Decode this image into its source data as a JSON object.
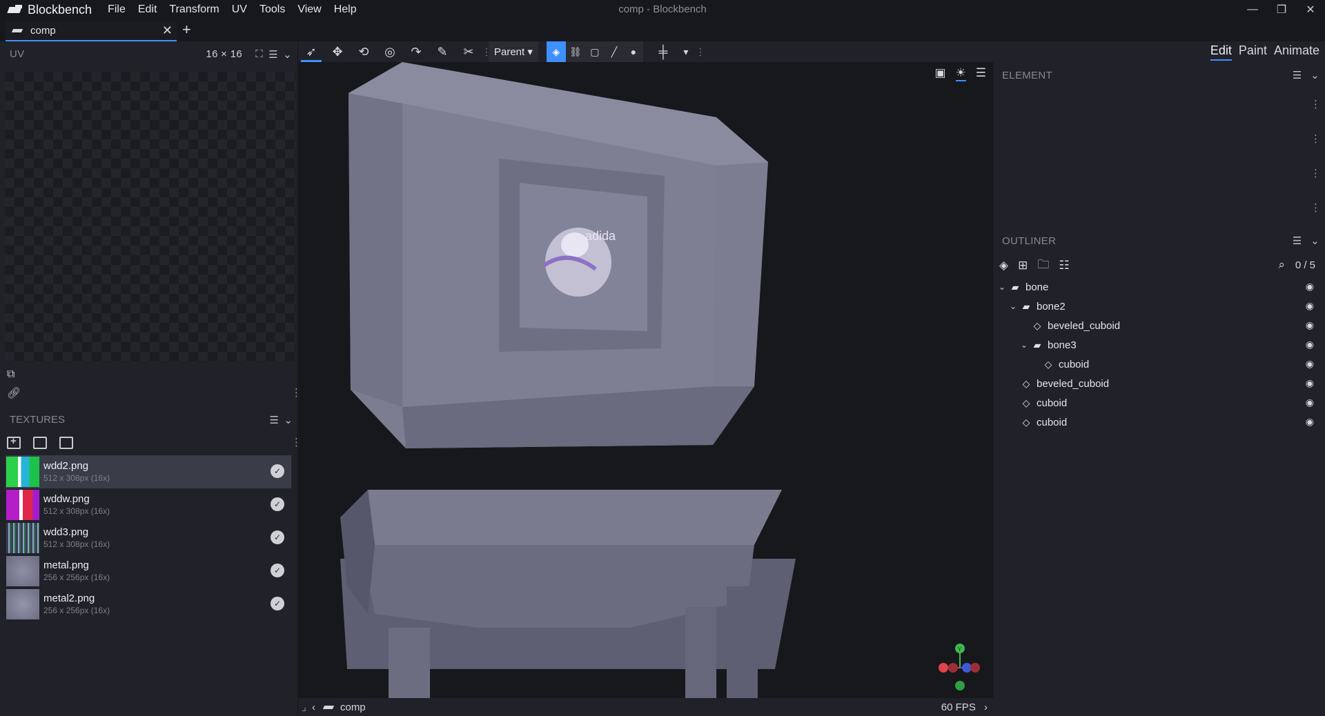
{
  "app": {
    "name": "Blockbench",
    "window_title": "comp - Blockbench",
    "menu": [
      "File",
      "Edit",
      "Transform",
      "UV",
      "Tools",
      "View",
      "Help"
    ],
    "window_controls": {
      "minimize": "—",
      "restore": "❐",
      "close": "✕"
    }
  },
  "tabs": [
    {
      "label": "comp"
    }
  ],
  "tab_add": "+",
  "uv_panel": {
    "title": "UV",
    "size": "16 × 16"
  },
  "textures_panel": {
    "title": "TEXTURES",
    "items": [
      {
        "name": "wdd2.png",
        "size": "512 x 308px (16x)",
        "selected": true
      },
      {
        "name": "wddw.png",
        "size": "512 x 308px (16x)",
        "selected": false
      },
      {
        "name": "wdd3.png",
        "size": "512 x 308px (16x)",
        "selected": false
      },
      {
        "name": "metal.png",
        "size": "256 x 256px (16x)",
        "selected": false
      },
      {
        "name": "metal2.png",
        "size": "256 x 256px (16x)",
        "selected": false
      }
    ]
  },
  "toolbar": {
    "pivot_select": "Parent ▾",
    "modes": [
      "Edit",
      "Paint",
      "Animate"
    ],
    "active_mode": "Edit"
  },
  "element_panel": {
    "title": "ELEMENT"
  },
  "outliner": {
    "title": "OUTLINER",
    "count": "0 / 5",
    "nodes": [
      {
        "label": "bone",
        "type": "folder",
        "depth": 0,
        "expanded": true
      },
      {
        "label": "bone2",
        "type": "folder",
        "depth": 1,
        "expanded": true
      },
      {
        "label": "beveled_cuboid",
        "type": "mesh",
        "depth": 2
      },
      {
        "label": "bone3",
        "type": "folder",
        "depth": 2,
        "expanded": true
      },
      {
        "label": "cuboid",
        "type": "mesh",
        "depth": 3
      },
      {
        "label": "beveled_cuboid",
        "type": "mesh",
        "depth": 1
      },
      {
        "label": "cuboid",
        "type": "mesh",
        "depth": 1
      },
      {
        "label": "cuboid",
        "type": "mesh",
        "depth": 1
      }
    ]
  },
  "status": {
    "model_name": "comp",
    "fps": "60 FPS"
  },
  "viewport": {
    "decal_text": "adida",
    "axis_y": "Y"
  },
  "colors": {
    "accent": "#3e90ff",
    "panel": "#212229",
    "viewport_bg": "#17181c",
    "model": "#7c7d90"
  }
}
